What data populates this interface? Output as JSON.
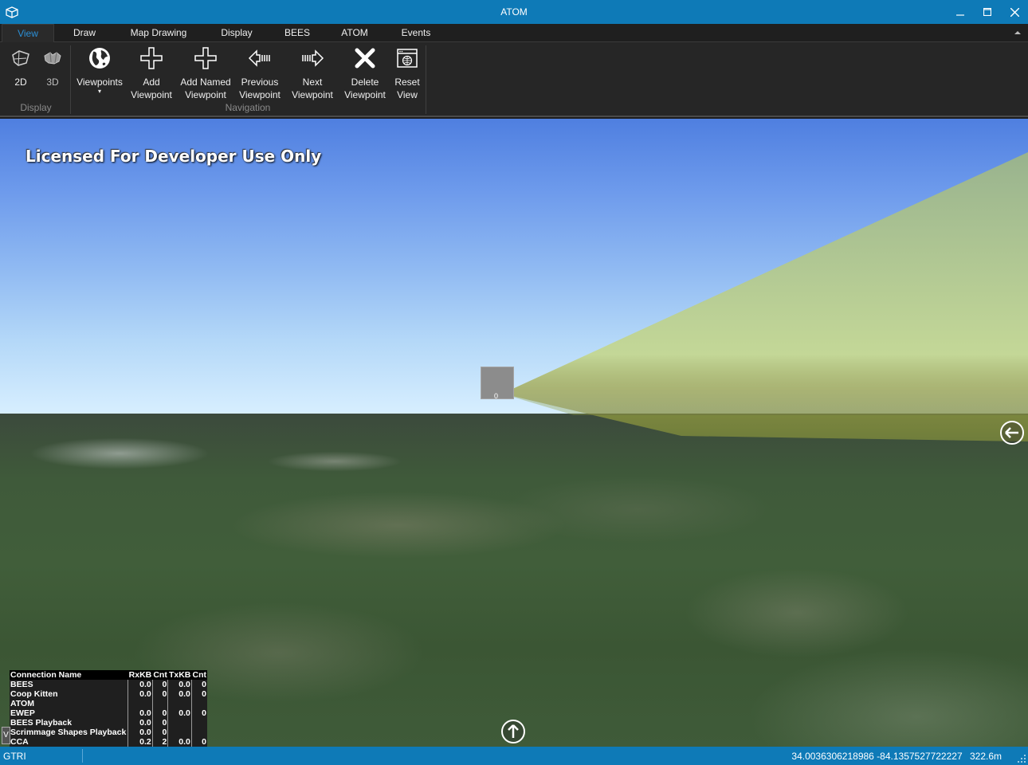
{
  "window": {
    "title": "ATOM",
    "controls": {
      "minimize": "minimize",
      "maximize": "maximize",
      "close": "close"
    }
  },
  "menu": {
    "tabs": [
      {
        "label": "View",
        "active": true
      },
      {
        "label": "Draw"
      },
      {
        "label": "Map Drawing"
      },
      {
        "label": "Display"
      },
      {
        "label": "BEES"
      },
      {
        "label": "ATOM"
      },
      {
        "label": "Events"
      }
    ]
  },
  "ribbon": {
    "display_group": {
      "label": "Display",
      "buttons": [
        {
          "label": "2D",
          "icon": "map-2d-icon"
        },
        {
          "label": "3D",
          "icon": "globe-3d-icon"
        }
      ]
    },
    "navigation_group": {
      "label": "Navigation",
      "viewpoints": {
        "label": "Viewpoints",
        "dropdown": "▾"
      },
      "add_viewpoint": {
        "line1": "Add",
        "line2": "Viewpoint"
      },
      "add_named_viewpoint": {
        "line1": "Add Named",
        "line2": "Viewpoint"
      },
      "previous_viewpoint": {
        "line1": "Previous",
        "line2": "Viewpoint"
      },
      "next_viewpoint": {
        "line1": "Next",
        "line2": "Viewpoint"
      },
      "delete_viewpoint": {
        "line1": "Delete",
        "line2": "Viewpoint"
      },
      "reset_view": {
        "line1": "Reset",
        "line2": "View"
      }
    }
  },
  "map": {
    "watermark": "Licensed For Developer Use Only",
    "model_label": "0",
    "colors": {
      "fov_cone": "#c8d98a",
      "sky_top": "#4f7fe0",
      "sky_horizon": "#d8efff"
    }
  },
  "connections": {
    "headers": [
      "Connection Name",
      "RxKB",
      "Cnt",
      "TxKB",
      "Cnt"
    ],
    "rows": [
      [
        "BEES",
        "0.0",
        "0",
        "0.0",
        "0"
      ],
      [
        "Coop Kitten",
        "0.0",
        "0",
        "0.0",
        "0"
      ],
      [
        "ATOM",
        "",
        "",
        "",
        ""
      ],
      [
        "EWEP",
        "0.0",
        "0",
        "0.0",
        "0"
      ],
      [
        "BEES Playback",
        "0.0",
        "0",
        "",
        ""
      ],
      [
        "Scrimmage Shapes Playback",
        "0.0",
        "0",
        "",
        ""
      ],
      [
        "CCA",
        "0.2",
        "2",
        "0.0",
        "0"
      ]
    ],
    "toggle_label": "V"
  },
  "status": {
    "left": "GTRI",
    "coordinates": "34.0036306218986 -84.1357527722227",
    "altitude": "322.6m"
  }
}
